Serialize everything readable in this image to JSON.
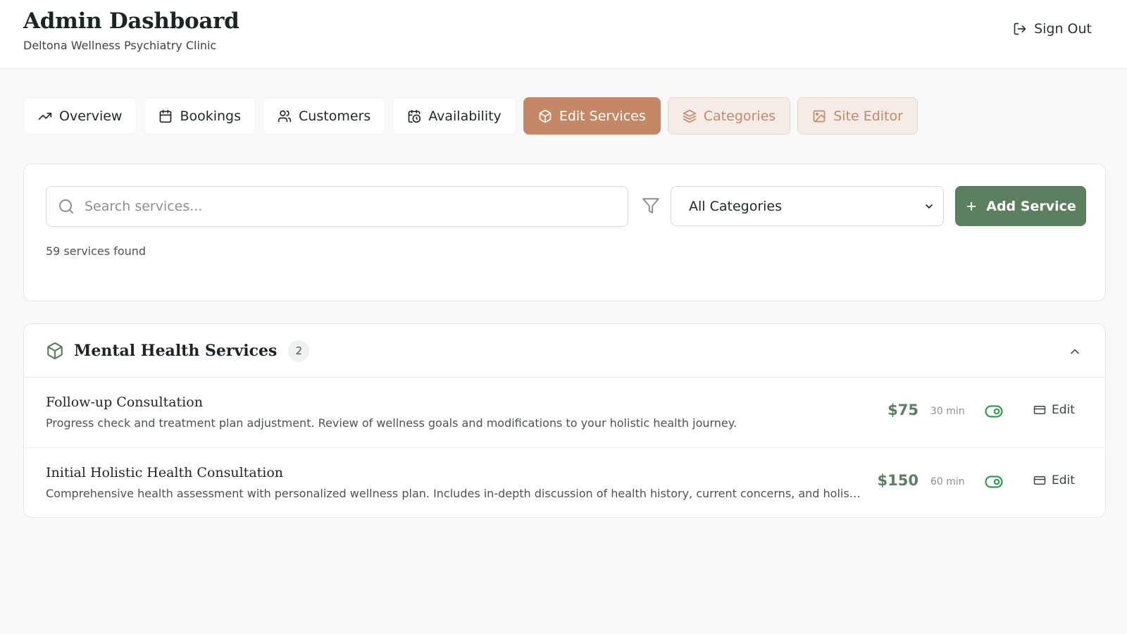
{
  "header": {
    "title": "Admin Dashboard",
    "subtitle": "Deltona Wellness Psychiatry Clinic",
    "sign_out_label": "Sign Out"
  },
  "tabs": [
    {
      "label": "Overview",
      "icon": "trending-up-icon"
    },
    {
      "label": "Bookings",
      "icon": "calendar-icon"
    },
    {
      "label": "Customers",
      "icon": "users-icon"
    },
    {
      "label": "Availability",
      "icon": "calendar-clock-icon"
    },
    {
      "label": "Edit Services",
      "icon": "package-icon",
      "active": true
    },
    {
      "label": "Categories",
      "icon": "layers-icon"
    },
    {
      "label": "Site Editor",
      "icon": "image-icon"
    }
  ],
  "filters": {
    "search_placeholder": "Search services...",
    "search_value": "",
    "category_selected": "All Categories",
    "add_button_label": "Add Service",
    "results_count": "59 services found"
  },
  "category": {
    "name": "Mental Health Services",
    "count": "2",
    "expanded": true
  },
  "services": [
    {
      "name": "Follow-up Consultation",
      "description": "Progress check and treatment plan adjustment. Review of wellness goals and modifications to your holistic health journey.",
      "price": "$75",
      "duration": "30 min",
      "active": true,
      "edit_label": "Edit"
    },
    {
      "name": "Initial Holistic Health Consultation",
      "description": "Comprehensive health assessment with personalized wellness plan. Includes in-depth discussion of health history, current concerns, and holistic treatment options.",
      "price": "$150",
      "duration": "60 min",
      "active": true,
      "edit_label": "Edit"
    }
  ],
  "colors": {
    "accent_terracotta": "#c48868",
    "accent_green": "#5b7f5f",
    "background": "#f9f9f9"
  }
}
